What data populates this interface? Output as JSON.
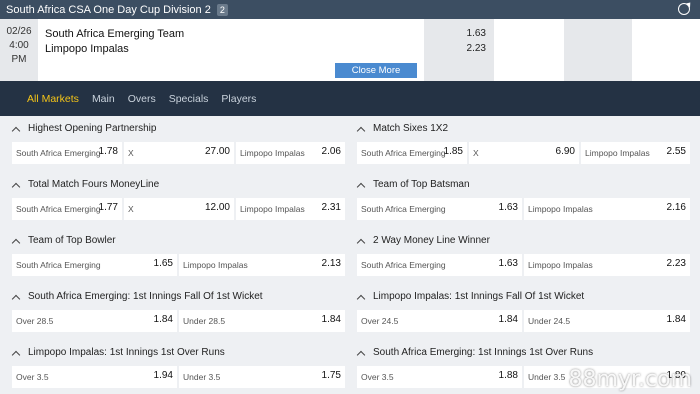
{
  "header": {
    "title": "South Africa CSA One Day Cup Division 2",
    "count": "2"
  },
  "match": {
    "date": "02/26",
    "time": "4:00",
    "ampm": "PM",
    "team1": "South Africa Emerging Team",
    "team2": "Limpopo Impalas",
    "odds1": "1.63",
    "odds2": "2.23",
    "close_label": "Close More Markets"
  },
  "tabs": [
    {
      "label": "All Markets",
      "active": true
    },
    {
      "label": "Main"
    },
    {
      "label": "Overs"
    },
    {
      "label": "Specials"
    },
    {
      "label": "Players"
    }
  ],
  "markets": [
    {
      "title": "Highest Opening Partnership",
      "cells": [
        {
          "label": "South Africa Emerging",
          "odd": "1.78",
          "w": 110
        },
        {
          "label": "X",
          "odd": "27.00",
          "w": 110
        },
        {
          "label": "Limpopo Impalas",
          "odd": "2.06",
          "w": 109
        }
      ]
    },
    {
      "title": "Match Sixes 1X2",
      "cells": [
        {
          "label": "South Africa Emerging",
          "odd": "1.85",
          "w": 110
        },
        {
          "label": "X",
          "odd": "6.90",
          "w": 110
        },
        {
          "label": "Limpopo Impalas",
          "odd": "2.55",
          "w": 109
        }
      ]
    },
    {
      "title": "Total Match Fours MoneyLine",
      "cells": [
        {
          "label": "South Africa Emerging",
          "odd": "1.77",
          "w": 110
        },
        {
          "label": "X",
          "odd": "12.00",
          "w": 110
        },
        {
          "label": "Limpopo Impalas",
          "odd": "2.31",
          "w": 109
        }
      ]
    },
    {
      "title": "Team of Top Batsman",
      "cells": [
        {
          "label": "South Africa Emerging",
          "odd": "1.63",
          "w": 165
        },
        {
          "label": "Limpopo Impalas",
          "odd": "2.16",
          "w": 166
        }
      ]
    },
    {
      "title": "Team of Top Bowler",
      "cells": [
        {
          "label": "South Africa Emerging",
          "odd": "1.65",
          "w": 165
        },
        {
          "label": "Limpopo Impalas",
          "odd": "2.13",
          "w": 166
        }
      ]
    },
    {
      "title": "2 Way Money Line Winner",
      "cells": [
        {
          "label": "South Africa Emerging",
          "odd": "1.63",
          "w": 165
        },
        {
          "label": "Limpopo Impalas",
          "odd": "2.23",
          "w": 166
        }
      ]
    },
    {
      "title": "South Africa Emerging: 1st Innings Fall Of 1st Wicket",
      "cells": [
        {
          "label": "Over 28.5",
          "odd": "1.84",
          "w": 165
        },
        {
          "label": "Under 28.5",
          "odd": "1.84",
          "w": 166
        }
      ]
    },
    {
      "title": "Limpopo Impalas: 1st Innings Fall Of 1st Wicket",
      "cells": [
        {
          "label": "Over 24.5",
          "odd": "1.84",
          "w": 165
        },
        {
          "label": "Under 24.5",
          "odd": "1.84",
          "w": 166
        }
      ]
    },
    {
      "title": "Limpopo Impalas: 1st Innings 1st Over Runs",
      "cells": [
        {
          "label": "Over 3.5",
          "odd": "1.94",
          "w": 165
        },
        {
          "label": "Under 3.5",
          "odd": "1.75",
          "w": 166
        }
      ]
    },
    {
      "title": "South Africa Emerging: 1st Innings 1st Over Runs",
      "cells": [
        {
          "label": "Over 3.5",
          "odd": "1.88",
          "w": 165
        },
        {
          "label": "Under 3.5",
          "odd": "1.80",
          "w": 166
        }
      ]
    }
  ],
  "watermark": "88myr.com"
}
